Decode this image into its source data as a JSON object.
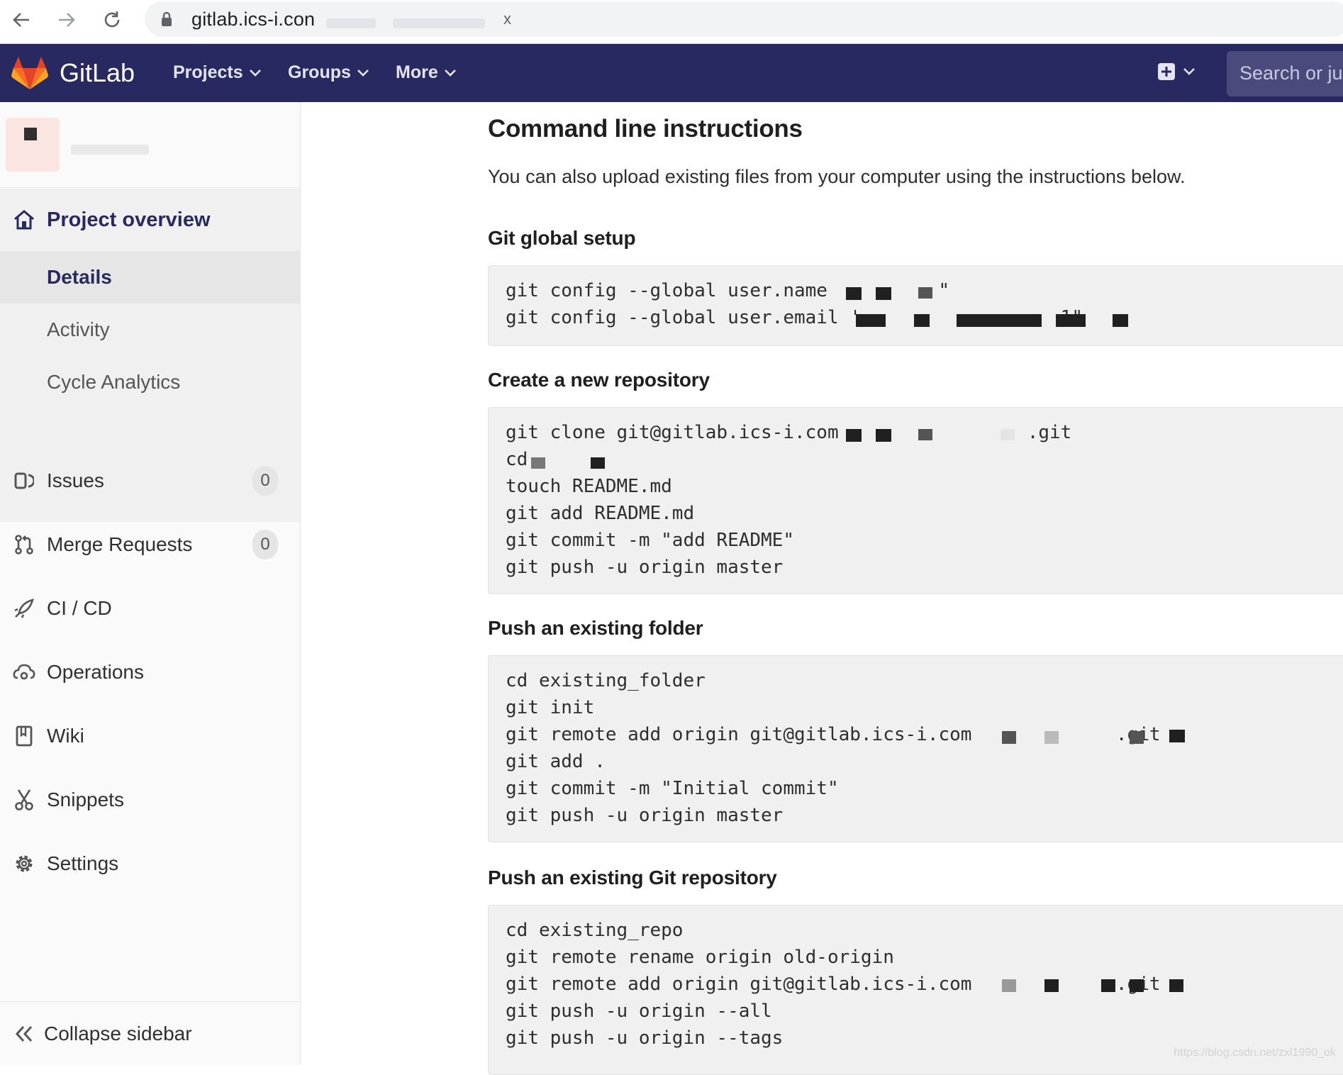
{
  "browser": {
    "url": "gitlab.ics-i.con",
    "stop_glyph": "x"
  },
  "header": {
    "brand": "GitLab",
    "menus": [
      "Projects",
      "Groups",
      "More"
    ],
    "search_placeholder": "Search or ju"
  },
  "sidebar": {
    "project_overview": "Project overview",
    "sub_items": [
      "Details",
      "Activity",
      "Cycle Analytics"
    ],
    "active_sub": "Details",
    "items": [
      {
        "label": "Issues",
        "count": "0",
        "icon": "issues-icon"
      },
      {
        "label": "Merge Requests",
        "count": "0",
        "icon": "merge-request-icon"
      },
      {
        "label": "CI / CD",
        "icon": "rocket-icon"
      },
      {
        "label": "Operations",
        "icon": "cloud-gear-icon"
      },
      {
        "label": "Wiki",
        "icon": "book-icon"
      },
      {
        "label": "Snippets",
        "icon": "scissors-icon"
      },
      {
        "label": "Settings",
        "icon": "gear-icon"
      }
    ],
    "collapse": "Collapse sidebar"
  },
  "main": {
    "title": "Command line instructions",
    "intro": "You can also upload existing files from your computer using the instructions below.",
    "sections": [
      {
        "heading": "Git global setup",
        "lines": [
          "git config --global user.name          \"",
          "git config --global user.email '                  1\""
        ]
      },
      {
        "heading": "Create a new repository",
        "lines": [
          "git clone git@gitlab.ics-i.com                 .git",
          "cd",
          "touch README.md",
          "git add README.md",
          "git commit -m \"add README\"",
          "git push -u origin master"
        ]
      },
      {
        "heading": "Push an existing folder",
        "lines": [
          "cd existing_folder",
          "git init",
          "git remote add origin git@gitlab.ics-i.com             .git",
          "git add .",
          "git commit -m \"Initial commit\"",
          "git push -u origin master"
        ]
      },
      {
        "heading": "Push an existing Git repository",
        "lines": [
          "cd existing_repo",
          "git remote rename origin old-origin",
          "git remote add origin git@gitlab.ics-i.com             .git",
          "git push -u origin --all",
          "git push -u origin --tags"
        ]
      }
    ]
  },
  "watermark": "https://blog.csdn.net/zxl1990_ok",
  "colors": {
    "header_bg": "#292961",
    "sidebar_bg": "#fafafa",
    "active_text": "#292961",
    "code_bg": "#f0f0f0"
  }
}
